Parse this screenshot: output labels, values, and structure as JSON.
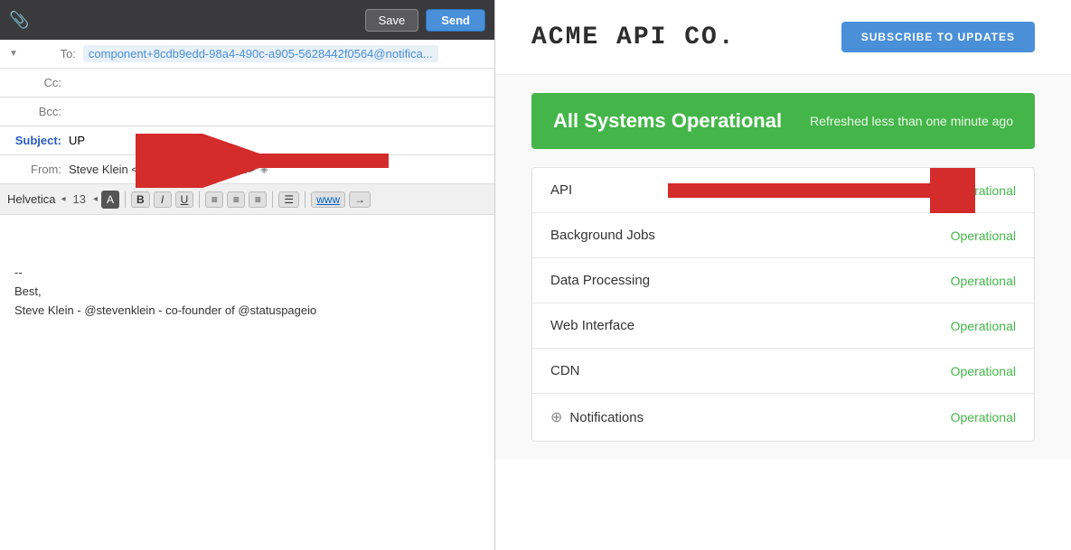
{
  "email": {
    "window_title": "UP",
    "toolbar": {
      "save_label": "Save",
      "send_label": "Send"
    },
    "fields": {
      "to_label": "To:",
      "to_value": "component+8cdb9edd-98a4-490c-a905-5628442f0564@notifica...",
      "cc_label": "Cc:",
      "bcc_label": "Bcc:",
      "subject_label": "Subject:",
      "subject_value": "UP",
      "from_label": "From:",
      "from_value": "Steve Klein <steve@statuspage.io>"
    },
    "formatting": {
      "font": "Helvetica",
      "size": "13",
      "bold": "B",
      "italic": "I",
      "underline": "U"
    },
    "body": "--\nBest,\nSteve Klein - @stevenklein - co-founder of @statuspageio"
  },
  "status_page": {
    "company_name": "ACME API CO.",
    "subscribe_label": "SUBSCRIBE TO UPDATES",
    "banner": {
      "title": "All Systems Operational",
      "refresh": "Refreshed less than one minute ago"
    },
    "services": [
      {
        "name": "API",
        "status": "Operational",
        "has_help": true
      },
      {
        "name": "Background Jobs",
        "status": "Operational",
        "has_help": false
      },
      {
        "name": "Data Processing",
        "status": "Operational",
        "has_help": false
      },
      {
        "name": "Web Interface",
        "status": "Operational",
        "has_help": false
      },
      {
        "name": "CDN",
        "status": "Operational",
        "has_help": false
      },
      {
        "name": "Notifications",
        "status": "Operational",
        "has_help": false,
        "has_plus": true
      }
    ]
  }
}
